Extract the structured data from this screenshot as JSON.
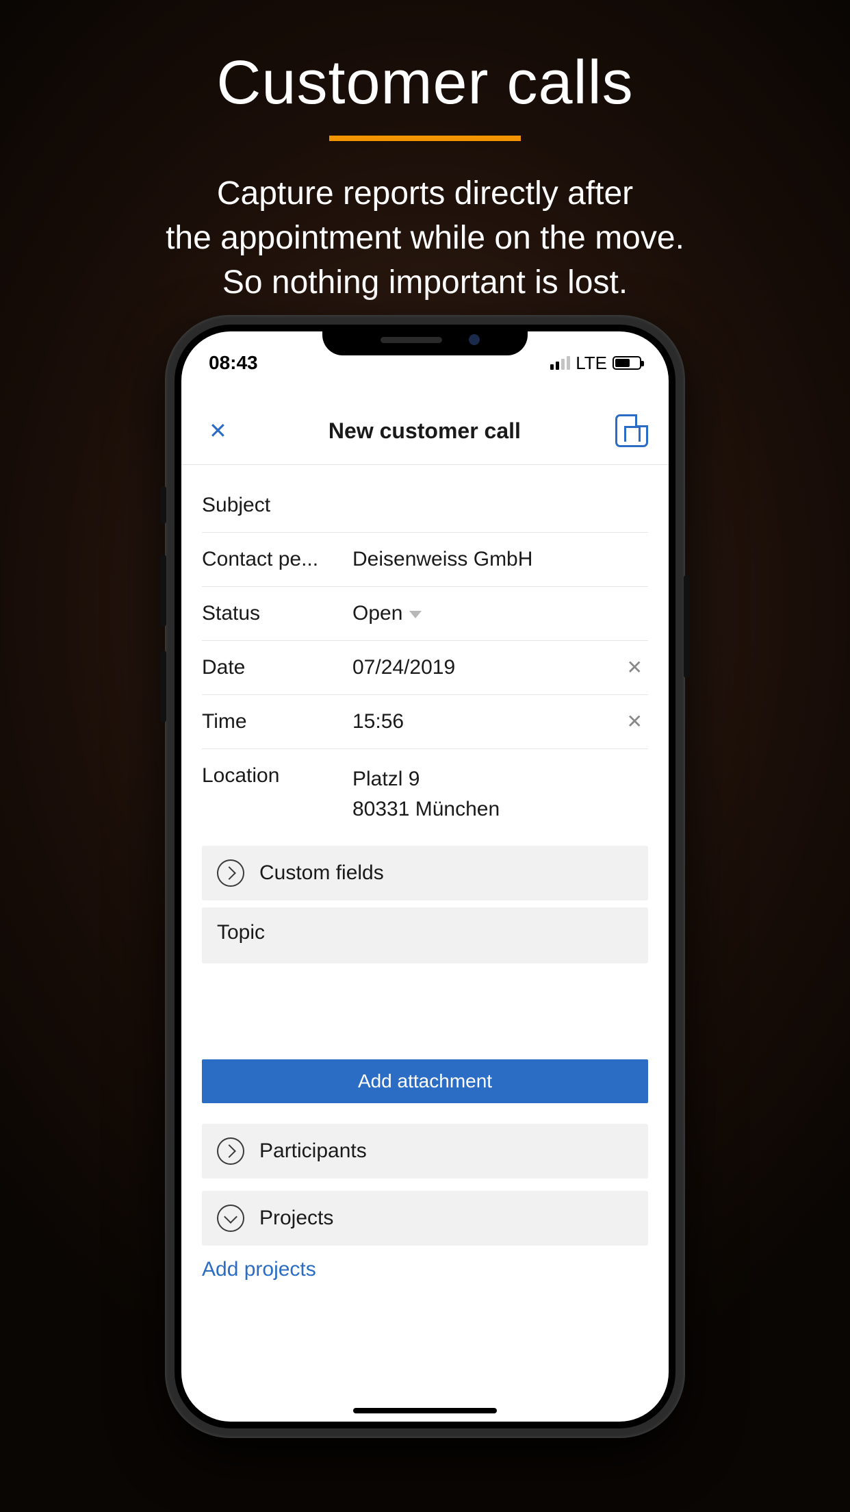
{
  "hero": {
    "title": "Customer calls",
    "subtitle_line1": "Capture reports directly after",
    "subtitle_line2": "the appointment while on the move.",
    "subtitle_line3": "So nothing important is lost."
  },
  "status": {
    "time": "08:43",
    "network": "LTE"
  },
  "nav": {
    "title": "New customer call"
  },
  "form": {
    "subject_label": "Subject",
    "contact_label": "Contact pe...",
    "contact_value": "Deisenweiss GmbH",
    "status_label": "Status",
    "status_value": "Open",
    "date_label": "Date",
    "date_value": "07/24/2019",
    "time_label": "Time",
    "time_value": "15:56",
    "location_label": "Location",
    "location_value": "Platzl 9\n80331 München"
  },
  "sections": {
    "custom_fields": "Custom fields",
    "topic": "Topic",
    "add_attachment": "Add attachment",
    "participants": "Participants",
    "projects": "Projects",
    "add_projects": "Add projects"
  }
}
